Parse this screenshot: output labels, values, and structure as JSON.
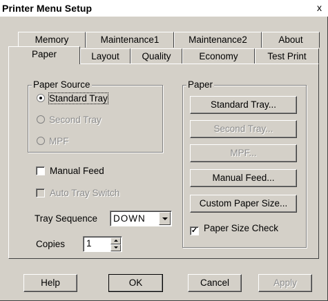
{
  "window": {
    "title": "Printer Menu Setup",
    "close_glyph": "x"
  },
  "tabs": {
    "back_row": [
      {
        "label": "Memory"
      },
      {
        "label": "Maintenance1"
      },
      {
        "label": "Maintenance2"
      },
      {
        "label": "About"
      }
    ],
    "front_row": [
      {
        "label": "Paper",
        "active": true
      },
      {
        "label": "Layout"
      },
      {
        "label": "Quality"
      },
      {
        "label": "Economy"
      },
      {
        "label": "Test Print"
      }
    ]
  },
  "paper_source": {
    "label": "Paper Source",
    "options": [
      {
        "label": "Standard Tray",
        "selected": true,
        "enabled": true
      },
      {
        "label": "Second Tray",
        "selected": false,
        "enabled": false
      },
      {
        "label": "MPF",
        "selected": false,
        "enabled": false
      }
    ]
  },
  "manual_feed": {
    "label": "Manual Feed",
    "checked": false,
    "enabled": true
  },
  "auto_tray_switch": {
    "label": "Auto Tray Switch",
    "checked": false,
    "enabled": false
  },
  "tray_sequence": {
    "label": "Tray Sequence",
    "value": "DOWN"
  },
  "copies": {
    "label": "Copies",
    "value": "1"
  },
  "paper_group": {
    "label": "Paper",
    "buttons": [
      {
        "label": "Standard Tray...",
        "enabled": true
      },
      {
        "label": "Second Tray...",
        "enabled": false
      },
      {
        "label": "MPF...",
        "enabled": false
      },
      {
        "label": "Manual Feed...",
        "enabled": true
      },
      {
        "label": "Custom Paper Size...",
        "enabled": true
      }
    ],
    "paper_size_check": {
      "label": "Paper Size Check",
      "checked": true
    }
  },
  "footer": {
    "help": "Help",
    "ok": "OK",
    "cancel": "Cancel",
    "apply": "Apply"
  },
  "icons": {
    "radio_checked": "radio-dot",
    "checkbox_checked": "checkmark",
    "dropdown": "chevron-down-icon",
    "spin_up": "triangle-up-icon",
    "spin_down": "triangle-down-icon"
  },
  "colors": {
    "face": "#d4d0c8",
    "disabled_text": "#8c8c8c"
  }
}
